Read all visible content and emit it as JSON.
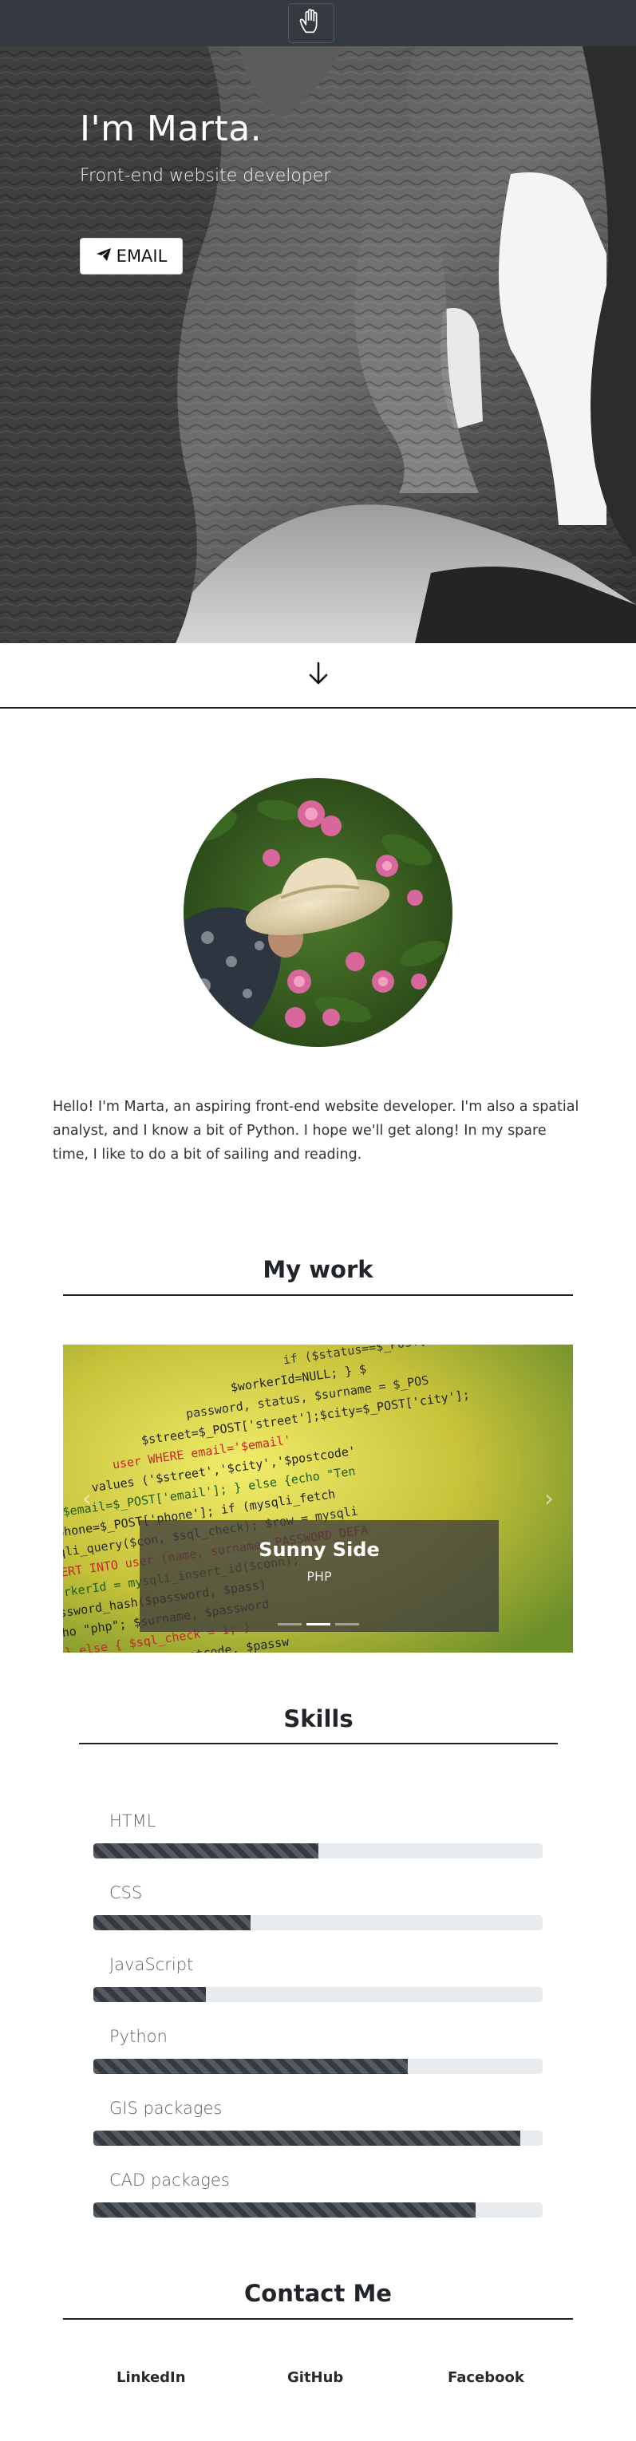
{
  "navbar": {
    "logo_icon": "hand-icon"
  },
  "hero": {
    "title": "I'm Marta.",
    "subtitle": "Front-end website developer",
    "email_button": {
      "label": "EMAIL",
      "icon": "paper-plane-icon"
    }
  },
  "scroll_down": {
    "icon": "arrow-down-icon"
  },
  "about": {
    "text": "Hello! I'm Marta, an aspiring front-end website developer. I'm also a spatial analyst, and I know a bit of Python. I hope we'll get along! In my spare time, I like to do a bit of sailing and reading."
  },
  "work": {
    "heading": "My work",
    "slides": [
      {
        "title": "Sunny Side",
        "subtitle": "PHP"
      }
    ]
  },
  "skills": {
    "heading": "Skills",
    "items": [
      {
        "name": "HTML",
        "percent": 50
      },
      {
        "name": "CSS",
        "percent": 35
      },
      {
        "name": "JavaScript",
        "percent": 25
      },
      {
        "name": "Python",
        "percent": 70
      },
      {
        "name": "GIS packages",
        "percent": 95
      },
      {
        "name": "CAD packages",
        "percent": 85
      }
    ],
    "bar_color": "#343a40",
    "track_color": "#e9ecef"
  },
  "contact": {
    "heading": "Contact Me",
    "links": [
      "LinkedIn",
      "GitHub",
      "Facebook"
    ]
  }
}
